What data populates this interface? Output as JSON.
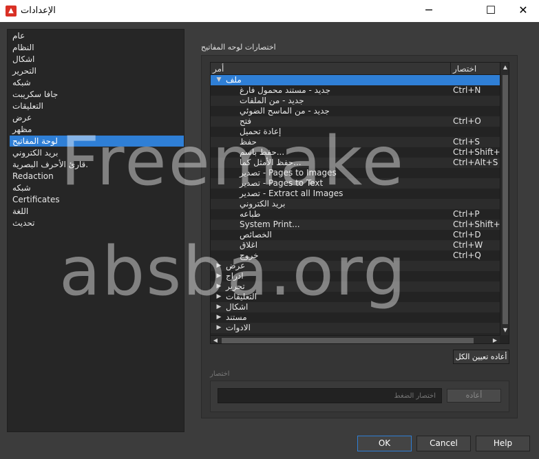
{
  "window": {
    "title": "الإعدادات",
    "app_icon": "app-logo-icon",
    "minimize_icon": "─",
    "maximize_icon": "☐",
    "close_icon": "✕"
  },
  "sidebar": {
    "items": [
      {
        "label": "عام"
      },
      {
        "label": "النظام"
      },
      {
        "label": "اشكال"
      },
      {
        "label": "التحرير"
      },
      {
        "label": "شبكه"
      },
      {
        "label": "جافا سكريبت"
      },
      {
        "label": "التعليقات"
      },
      {
        "label": "عرض"
      },
      {
        "label": "مظهر"
      },
      {
        "label": "لوحة المفاتيح",
        "selected": true
      },
      {
        "label": "بريد الكتروني"
      },
      {
        "label": "قارئ الأحرف البصرية."
      },
      {
        "label": "Redaction"
      },
      {
        "label": "شبكه"
      },
      {
        "label": "Certificates"
      },
      {
        "label": "اللغة"
      },
      {
        "label": "تحديث"
      }
    ]
  },
  "shortcuts": {
    "section_title": "اختصارات لوحه المفاتيح",
    "columns": {
      "command": "أمر",
      "shortcut": "اختصار"
    },
    "rows": [
      {
        "command": "ملف",
        "shortcut": "",
        "level": 0,
        "expander": "▼",
        "selected": true
      },
      {
        "command": "جديد - مستند محمول فارغ",
        "shortcut": "Ctrl+N",
        "level": 1
      },
      {
        "command": "جديد - من الملفات",
        "shortcut": "",
        "level": 1
      },
      {
        "command": "جديد - من الماسح الضوئي",
        "shortcut": "",
        "level": 1
      },
      {
        "command": "فتح",
        "shortcut": "Ctrl+O",
        "level": 1
      },
      {
        "command": "إعادة تحميل",
        "shortcut": "",
        "level": 1
      },
      {
        "command": "حفظ",
        "shortcut": "Ctrl+S",
        "level": 1
      },
      {
        "command": "حفظ باسم...",
        "shortcut": "Ctrl+Shift+S",
        "level": 1
      },
      {
        "command": "حفظ الأمثل كما...",
        "shortcut": "Ctrl+Alt+S",
        "level": 1
      },
      {
        "command": "تصدير - Pages to Images",
        "shortcut": "",
        "level": 1
      },
      {
        "command": "تصدير - Pages to Text",
        "shortcut": "",
        "level": 1
      },
      {
        "command": "تصدير - Extract all Images",
        "shortcut": "",
        "level": 1
      },
      {
        "command": "بريد الكتروني",
        "shortcut": "",
        "level": 1
      },
      {
        "command": "طباعه",
        "shortcut": "Ctrl+P",
        "level": 1
      },
      {
        "command": "System Print...",
        "shortcut": "Ctrl+Shift+P",
        "level": 1
      },
      {
        "command": "الخصائص",
        "shortcut": "Ctrl+D",
        "level": 1
      },
      {
        "command": "اغلاق",
        "shortcut": "Ctrl+W",
        "level": 1
      },
      {
        "command": "خروج",
        "shortcut": "Ctrl+Q",
        "level": 1
      },
      {
        "command": "عرض",
        "shortcut": "",
        "level": 0,
        "expander": "▶"
      },
      {
        "command": "ادراج",
        "shortcut": "",
        "level": 0,
        "expander": "▶"
      },
      {
        "command": "تحرير",
        "shortcut": "",
        "level": 0,
        "expander": "▶"
      },
      {
        "command": "التعليقات",
        "shortcut": "",
        "level": 0,
        "expander": "▶"
      },
      {
        "command": "اشكال",
        "shortcut": "",
        "level": 0,
        "expander": "▶"
      },
      {
        "command": "مستند",
        "shortcut": "",
        "level": 0,
        "expander": "▶"
      },
      {
        "command": "الادوات",
        "shortcut": "",
        "level": 0,
        "expander": "▶"
      }
    ],
    "reset_all_label": "أعاده تعيين الكل",
    "shortcut_group_label": "اختصار",
    "shortcut_input_placeholder": "اختصار الضغط",
    "reset_label": "أعاده"
  },
  "footer": {
    "ok_label": "OK",
    "cancel_label": "Cancel",
    "help_label": "Help"
  },
  "watermark": {
    "line1": "Freemake",
    "line2": "absba.org"
  },
  "colors": {
    "accent": "#2f7fd6",
    "background": "#3c3c3c",
    "app_icon": "#d93025"
  }
}
